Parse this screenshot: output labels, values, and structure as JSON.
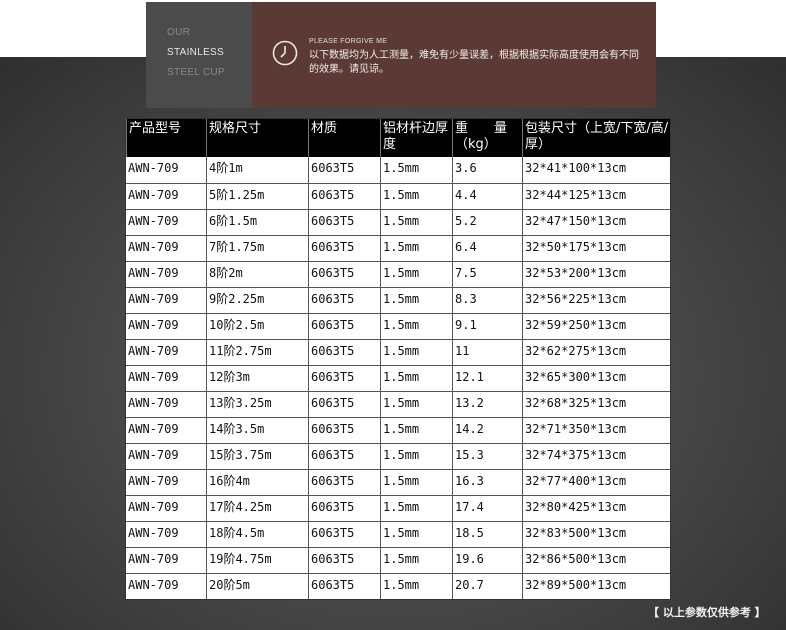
{
  "banner": {
    "left_lines": [
      "OUR",
      "STAINLESS",
      "STEEL CUP"
    ],
    "notice_title": "PLEASE FORGIVE ME",
    "notice_text": "以下数据均为人工测量，难免有少量误差，根据根据实际高度使用会有不同的效果。请见谅。"
  },
  "table": {
    "headers": [
      "产品型号",
      "规格尺寸",
      "材质",
      "铝材杆边厚度",
      "重　　量（kg）",
      "包装尺寸（上宽/下宽/高/厚）"
    ],
    "rows": [
      [
        "AWN-709",
        "4阶1m",
        "6063T5",
        "1.5mm",
        "3.6",
        "32*41*100*13cm"
      ],
      [
        "AWN-709",
        "5阶1.25m",
        "6063T5",
        "1.5mm",
        "4.4",
        "32*44*125*13cm"
      ],
      [
        "AWN-709",
        "6阶1.5m",
        "6063T5",
        "1.5mm",
        "5.2",
        "32*47*150*13cm"
      ],
      [
        "AWN-709",
        "7阶1.75m",
        "6063T5",
        "1.5mm",
        "6.4",
        "32*50*175*13cm"
      ],
      [
        "AWN-709",
        "8阶2m",
        "6063T5",
        "1.5mm",
        "7.5",
        "32*53*200*13cm"
      ],
      [
        "AWN-709",
        "9阶2.25m",
        "6063T5",
        "1.5mm",
        "8.3",
        "32*56*225*13cm"
      ],
      [
        "AWN-709",
        "10阶2.5m",
        "6063T5",
        "1.5mm",
        "9.1",
        "32*59*250*13cm"
      ],
      [
        "AWN-709",
        "11阶2.75m",
        "6063T5",
        "1.5mm",
        "11",
        "32*62*275*13cm"
      ],
      [
        "AWN-709",
        "12阶3m",
        "6063T5",
        "1.5mm",
        "12.1",
        "32*65*300*13cm"
      ],
      [
        "AWN-709",
        "13阶3.25m",
        "6063T5",
        "1.5mm",
        "13.2",
        "32*68*325*13cm"
      ],
      [
        "AWN-709",
        "14阶3.5m",
        "6063T5",
        "1.5mm",
        "14.2",
        "32*71*350*13cm"
      ],
      [
        "AWN-709",
        "15阶3.75m",
        "6063T5",
        "1.5mm",
        "15.3",
        "32*74*375*13cm"
      ],
      [
        "AWN-709",
        "16阶4m",
        "6063T5",
        "1.5mm",
        "16.3",
        "32*77*400*13cm"
      ],
      [
        "AWN-709",
        "17阶4.25m",
        "6063T5",
        "1.5mm",
        "17.4",
        "32*80*425*13cm"
      ],
      [
        "AWN-709",
        "18阶4.5m",
        "6063T5",
        "1.5mm",
        "18.5",
        "32*83*500*13cm"
      ],
      [
        "AWN-709",
        "19阶4.75m",
        "6063T5",
        "1.5mm",
        "19.6",
        "32*86*500*13cm"
      ],
      [
        "AWN-709",
        "20阶5m",
        "6063T5",
        "1.5mm",
        "20.7",
        "32*89*500*13cm"
      ]
    ]
  },
  "footnote": "【 以上参数仅供参考 】",
  "icons": {
    "clock": "clock-icon"
  },
  "colors": {
    "banner_left": "#4b4b4b",
    "banner_right": "#5b3a35",
    "header_bg": "#000000"
  }
}
